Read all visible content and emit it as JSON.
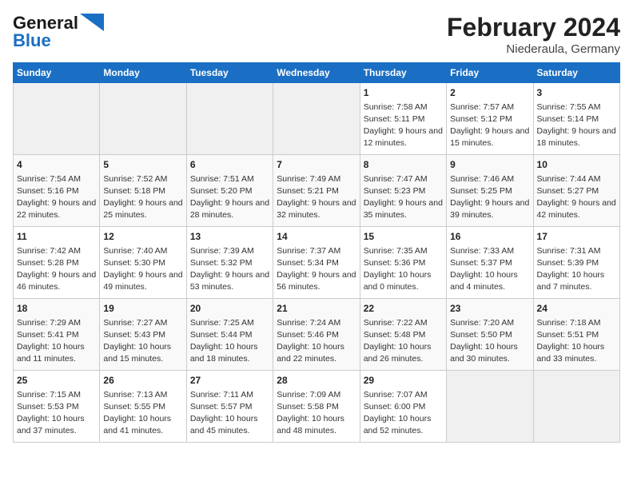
{
  "header": {
    "logo_general": "General",
    "logo_blue": "Blue",
    "title": "February 2024",
    "subtitle": "Niederaula, Germany"
  },
  "columns": [
    "Sunday",
    "Monday",
    "Tuesday",
    "Wednesday",
    "Thursday",
    "Friday",
    "Saturday"
  ],
  "rows": [
    [
      {
        "day": "",
        "content": ""
      },
      {
        "day": "",
        "content": ""
      },
      {
        "day": "",
        "content": ""
      },
      {
        "day": "",
        "content": ""
      },
      {
        "day": "1",
        "content": "Sunrise: 7:58 AM\nSunset: 5:11 PM\nDaylight: 9 hours and 12 minutes."
      },
      {
        "day": "2",
        "content": "Sunrise: 7:57 AM\nSunset: 5:12 PM\nDaylight: 9 hours and 15 minutes."
      },
      {
        "day": "3",
        "content": "Sunrise: 7:55 AM\nSunset: 5:14 PM\nDaylight: 9 hours and 18 minutes."
      }
    ],
    [
      {
        "day": "4",
        "content": "Sunrise: 7:54 AM\nSunset: 5:16 PM\nDaylight: 9 hours and 22 minutes."
      },
      {
        "day": "5",
        "content": "Sunrise: 7:52 AM\nSunset: 5:18 PM\nDaylight: 9 hours and 25 minutes."
      },
      {
        "day": "6",
        "content": "Sunrise: 7:51 AM\nSunset: 5:20 PM\nDaylight: 9 hours and 28 minutes."
      },
      {
        "day": "7",
        "content": "Sunrise: 7:49 AM\nSunset: 5:21 PM\nDaylight: 9 hours and 32 minutes."
      },
      {
        "day": "8",
        "content": "Sunrise: 7:47 AM\nSunset: 5:23 PM\nDaylight: 9 hours and 35 minutes."
      },
      {
        "day": "9",
        "content": "Sunrise: 7:46 AM\nSunset: 5:25 PM\nDaylight: 9 hours and 39 minutes."
      },
      {
        "day": "10",
        "content": "Sunrise: 7:44 AM\nSunset: 5:27 PM\nDaylight: 9 hours and 42 minutes."
      }
    ],
    [
      {
        "day": "11",
        "content": "Sunrise: 7:42 AM\nSunset: 5:28 PM\nDaylight: 9 hours and 46 minutes."
      },
      {
        "day": "12",
        "content": "Sunrise: 7:40 AM\nSunset: 5:30 PM\nDaylight: 9 hours and 49 minutes."
      },
      {
        "day": "13",
        "content": "Sunrise: 7:39 AM\nSunset: 5:32 PM\nDaylight: 9 hours and 53 minutes."
      },
      {
        "day": "14",
        "content": "Sunrise: 7:37 AM\nSunset: 5:34 PM\nDaylight: 9 hours and 56 minutes."
      },
      {
        "day": "15",
        "content": "Sunrise: 7:35 AM\nSunset: 5:36 PM\nDaylight: 10 hours and 0 minutes."
      },
      {
        "day": "16",
        "content": "Sunrise: 7:33 AM\nSunset: 5:37 PM\nDaylight: 10 hours and 4 minutes."
      },
      {
        "day": "17",
        "content": "Sunrise: 7:31 AM\nSunset: 5:39 PM\nDaylight: 10 hours and 7 minutes."
      }
    ],
    [
      {
        "day": "18",
        "content": "Sunrise: 7:29 AM\nSunset: 5:41 PM\nDaylight: 10 hours and 11 minutes."
      },
      {
        "day": "19",
        "content": "Sunrise: 7:27 AM\nSunset: 5:43 PM\nDaylight: 10 hours and 15 minutes."
      },
      {
        "day": "20",
        "content": "Sunrise: 7:25 AM\nSunset: 5:44 PM\nDaylight: 10 hours and 18 minutes."
      },
      {
        "day": "21",
        "content": "Sunrise: 7:24 AM\nSunset: 5:46 PM\nDaylight: 10 hours and 22 minutes."
      },
      {
        "day": "22",
        "content": "Sunrise: 7:22 AM\nSunset: 5:48 PM\nDaylight: 10 hours and 26 minutes."
      },
      {
        "day": "23",
        "content": "Sunrise: 7:20 AM\nSunset: 5:50 PM\nDaylight: 10 hours and 30 minutes."
      },
      {
        "day": "24",
        "content": "Sunrise: 7:18 AM\nSunset: 5:51 PM\nDaylight: 10 hours and 33 minutes."
      }
    ],
    [
      {
        "day": "25",
        "content": "Sunrise: 7:15 AM\nSunset: 5:53 PM\nDaylight: 10 hours and 37 minutes."
      },
      {
        "day": "26",
        "content": "Sunrise: 7:13 AM\nSunset: 5:55 PM\nDaylight: 10 hours and 41 minutes."
      },
      {
        "day": "27",
        "content": "Sunrise: 7:11 AM\nSunset: 5:57 PM\nDaylight: 10 hours and 45 minutes."
      },
      {
        "day": "28",
        "content": "Sunrise: 7:09 AM\nSunset: 5:58 PM\nDaylight: 10 hours and 48 minutes."
      },
      {
        "day": "29",
        "content": "Sunrise: 7:07 AM\nSunset: 6:00 PM\nDaylight: 10 hours and 52 minutes."
      },
      {
        "day": "",
        "content": ""
      },
      {
        "day": "",
        "content": ""
      }
    ]
  ]
}
